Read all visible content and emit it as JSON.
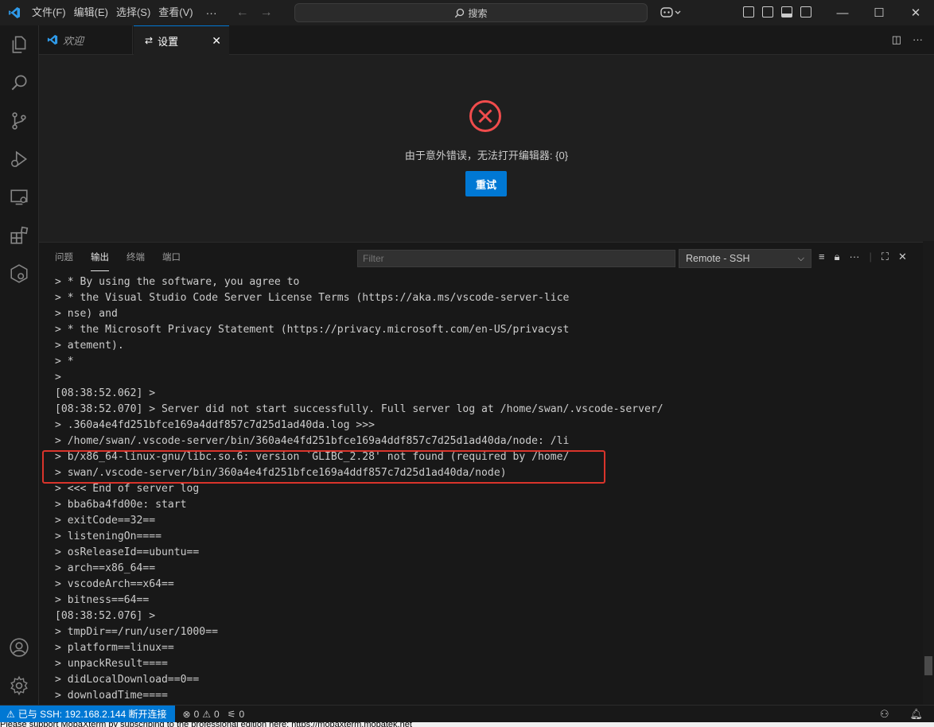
{
  "titlebar": {
    "menus": [
      "文件(F)",
      "编辑(E)",
      "选择(S)",
      "查看(V)"
    ],
    "more": "···",
    "search_placeholder": "搜索"
  },
  "tabs": [
    {
      "label": "欢迎"
    },
    {
      "label": "设置"
    }
  ],
  "editor": {
    "error_message": "由于意外错误，无法打开编辑器: {0}",
    "retry_label": "重试"
  },
  "panel": {
    "tabs": [
      "问题",
      "输出",
      "终端",
      "端口"
    ],
    "active_tab": "输出",
    "filter_placeholder": "Filter",
    "channel": "Remote - SSH",
    "log_lines": [
      "> * By using the software, you agree to",
      "> * the Visual Studio Code Server License Terms (https://aka.ms/vscode-server-lice",
      "> nse) and",
      "> * the Microsoft Privacy Statement (https://privacy.microsoft.com/en-US/privacyst",
      "> atement).",
      "> *",
      ">",
      "[08:38:52.062] >",
      "[08:38:52.070] > Server did not start successfully. Full server log at /home/swan/.vscode-server/",
      "> .360a4e4fd251bfce169a4ddf857c7d25d1ad40da.log >>>",
      "> /home/swan/.vscode-server/bin/360a4e4fd251bfce169a4ddf857c7d25d1ad40da/node: /li",
      "> b/x86_64-linux-gnu/libc.so.6: version `GLIBC_2.28' not found (required by /home/",
      "> swan/.vscode-server/bin/360a4e4fd251bfce169a4ddf857c7d25d1ad40da/node)",
      "> <<< End of server log",
      "> bba6ba4fd00e: start",
      "> exitCode==32==",
      "> listeningOn====",
      "> osReleaseId==ubuntu==",
      "> arch==x86_64==",
      "> vscodeArch==x64==",
      "> bitness==64==",
      "[08:38:52.076] >",
      "> tmpDir==/run/user/1000==",
      "> platform==linux==",
      "> unpackResult====",
      "> didLocalDownload==0==",
      "> downloadTime===="
    ]
  },
  "statusbar": {
    "remote": "已与 SSH: 192.168.2.144 断开连接",
    "errors": "0",
    "warnings": "0",
    "ports": "0"
  },
  "footer_text": "Please support MobaXterm by subscribing to the professional edition here:  https://mobaxterm.mobatek.net",
  "colors": {
    "accent": "#0078d4",
    "error": "#f14c4c",
    "highlight_box": "#d9342b"
  }
}
